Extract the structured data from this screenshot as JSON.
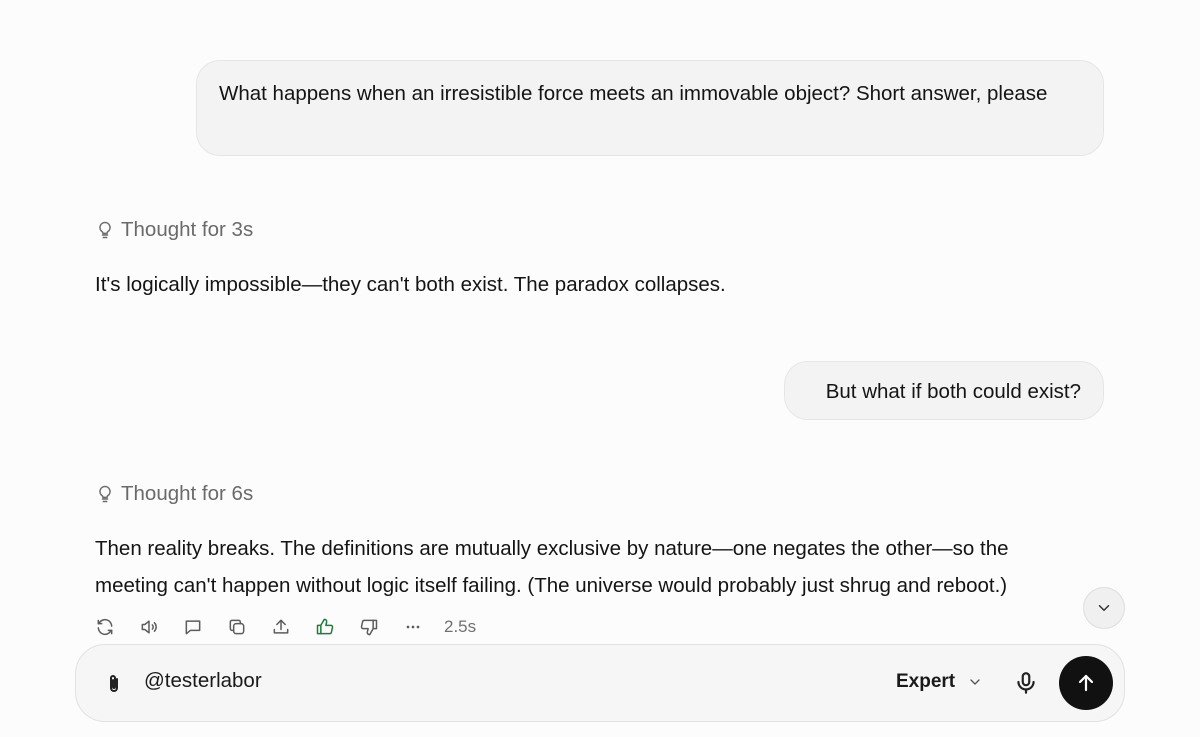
{
  "conversation": {
    "messages": [
      {
        "role": "user",
        "text": "What happens when an irresistible force meets an immovable object? Short answer, please"
      },
      {
        "role": "assistant",
        "thought": "Thought for 3s",
        "text": "It's logically impossible—they can't both exist. The paradox collapses."
      },
      {
        "role": "user",
        "text": "But what if both could exist?"
      },
      {
        "role": "assistant",
        "thought": "Thought for 6s",
        "text": "Then reality breaks. The definitions are mutually exclusive by nature—one negates the other—so the meeting can't happen without logic itself failing. (The universe would probably just shrug and reboot.)"
      }
    ]
  },
  "actions": {
    "icons": [
      "regenerate-icon",
      "read-aloud-icon",
      "comment-icon",
      "copy-icon",
      "share-icon",
      "thumbs-up-icon",
      "thumbs-down-icon",
      "more-icon"
    ],
    "timing": "2.5s",
    "liked_color": "#1a7f37"
  },
  "composer": {
    "value": "@testerlabor",
    "model": "Expert",
    "send_color": "#111111"
  }
}
